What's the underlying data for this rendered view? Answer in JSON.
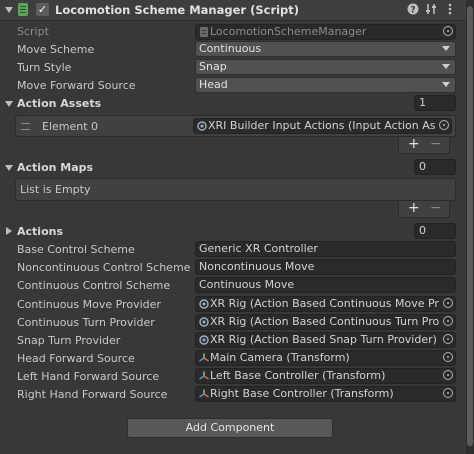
{
  "component": {
    "title": "Locomotion Scheme Manager (Script)",
    "icons": [
      "help-icon",
      "preset-icon",
      "context-menu-icon"
    ]
  },
  "fields": {
    "script": {
      "label": "Script",
      "value": "LocomotionSchemeManager"
    },
    "move_scheme": {
      "label": "Move Scheme",
      "value": "Continuous"
    },
    "turn_style": {
      "label": "Turn Style",
      "value": "Snap"
    },
    "move_forward_source": {
      "label": "Move Forward Source",
      "value": "Head"
    }
  },
  "action_assets": {
    "label": "Action Assets",
    "count": "1",
    "elements": [
      {
        "label": "Element 0",
        "value": "XRI Builder Input Actions (Input Action Asset)"
      }
    ],
    "add": "+",
    "remove": "−"
  },
  "action_maps": {
    "label": "Action Maps",
    "count": "0",
    "empty_text": "List is Empty",
    "add": "+",
    "remove": "−"
  },
  "actions": {
    "label": "Actions",
    "count": "0"
  },
  "schemes": {
    "base": {
      "label": "Base Control Scheme",
      "value": "Generic XR Controller"
    },
    "noncontinuous": {
      "label": "Noncontinuous Control Scheme",
      "value": "Noncontinuous Move"
    },
    "continuous": {
      "label": "Continuous Control Scheme",
      "value": "Continuous Move"
    }
  },
  "providers": {
    "continuous_move": {
      "label": "Continuous Move Provider",
      "value": "XR Rig (Action Based Continuous Move Provider)"
    },
    "continuous_turn": {
      "label": "Continuous Turn Provider",
      "value": "XR Rig (Action Based Continuous Turn Provider)"
    },
    "snap_turn": {
      "label": "Snap Turn Provider",
      "value": "XR Rig (Action Based Snap Turn Provider)"
    }
  },
  "forward_sources": {
    "head": {
      "label": "Head Forward Source",
      "value": "Main Camera (Transform)"
    },
    "left": {
      "label": "Left Hand Forward Source",
      "value": "Left Base Controller (Transform)"
    },
    "right": {
      "label": "Right Hand Forward Source",
      "value": "Right Base Controller (Transform)"
    }
  },
  "add_component": "Add Component"
}
